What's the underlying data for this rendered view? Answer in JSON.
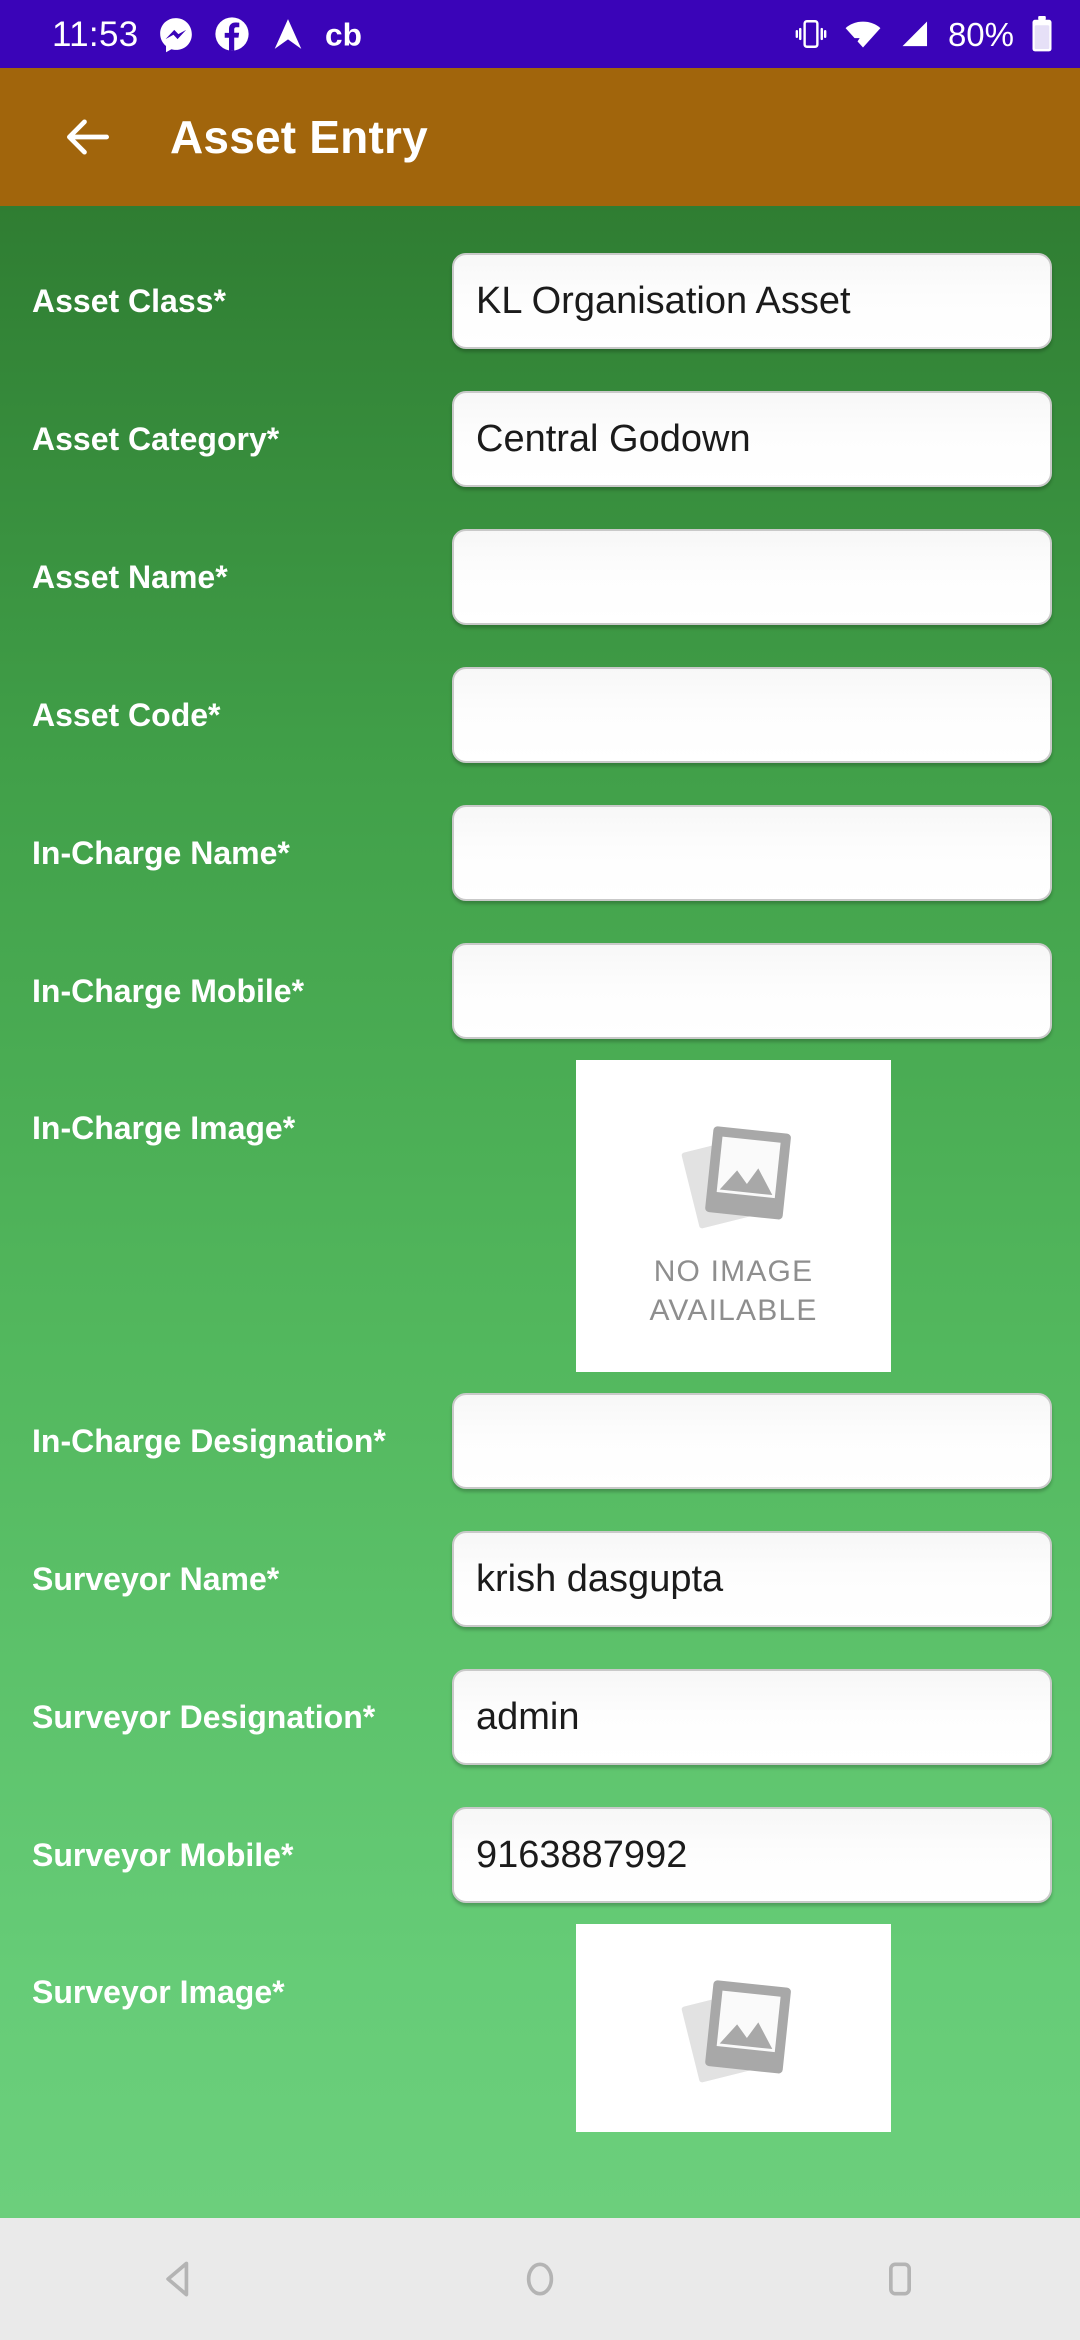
{
  "status_bar": {
    "clock": "11:53",
    "battery_percent": "80%",
    "icons": [
      "messenger-icon",
      "facebook-icon",
      "navigation-arrow-icon",
      "cb-icon",
      "vibrate-icon",
      "wifi-icon",
      "signal-icon",
      "battery-icon"
    ],
    "background_color": "#3a04b8"
  },
  "app_bar": {
    "title": "Asset Entry",
    "back_icon": "back-arrow-icon",
    "background_color": "#a1650c"
  },
  "form": {
    "background_gradient_top": "#2f7d32",
    "background_gradient_bottom": "#6ccf7c",
    "fields": [
      {
        "label": "Asset Class*",
        "value": "KL Organisation Asset",
        "type": "text"
      },
      {
        "label": "Asset Category*",
        "value": "Central Godown",
        "type": "text"
      },
      {
        "label": "Asset Name*",
        "value": "",
        "type": "text"
      },
      {
        "label": "Asset Code*",
        "value": "",
        "type": "text"
      },
      {
        "label": "In-Charge Name*",
        "value": "",
        "type": "text"
      },
      {
        "label": "In-Charge Mobile*",
        "value": "",
        "type": "text"
      },
      {
        "label": "In-Charge Image*",
        "value": "",
        "type": "image",
        "placeholder_line1": "NO IMAGE",
        "placeholder_line2": "AVAILABLE"
      },
      {
        "label": "In-Charge Designation*",
        "value": "",
        "type": "text"
      },
      {
        "label": "Surveyor Name*",
        "value": "krish dasgupta",
        "type": "text"
      },
      {
        "label": "Surveyor Designation*",
        "value": "admin",
        "type": "text"
      },
      {
        "label": "Surveyor Mobile*",
        "value": "9163887992",
        "type": "text"
      },
      {
        "label": "Surveyor Image*",
        "value": "",
        "type": "image",
        "placeholder_line1": "",
        "placeholder_line2": ""
      }
    ]
  },
  "nav_bar": {
    "buttons": [
      "back-triangle-icon",
      "home-circle-icon",
      "recents-square-icon"
    ],
    "background_color": "#eaeaea"
  }
}
